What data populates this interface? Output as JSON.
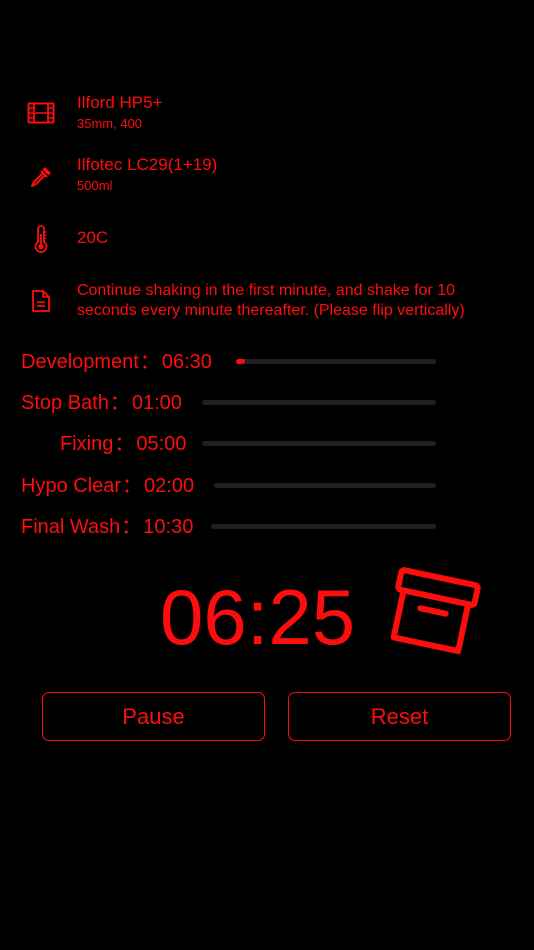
{
  "film": {
    "icon": "film-icon",
    "name": "Ilford HP5+",
    "detail": "35mm, 400"
  },
  "developer": {
    "icon": "dropper-icon",
    "name": "Ilfotec LC29(1+19)",
    "detail": "500ml"
  },
  "temperature": {
    "icon": "thermometer-icon",
    "value": "20C"
  },
  "instructions": {
    "icon": "document-icon",
    "text": "Continue shaking in the first minute, and shake for 10 seconds every minute thereafter. (Please flip vertically)"
  },
  "separator": "：",
  "steps": [
    {
      "label": "Development",
      "time": "06:30",
      "progress": 0.02
    },
    {
      "label": "Stop Bath",
      "time": "01:00",
      "progress": 0
    },
    {
      "label": "Fixing",
      "time": "05:00",
      "progress": 0
    },
    {
      "label": "Hypo Clear",
      "time": "02:00",
      "progress": 0
    },
    {
      "label": "Final Wash",
      "time": "10:30",
      "progress": 0
    }
  ],
  "timer": {
    "value": "06:25",
    "icon": "storage-box-icon"
  },
  "buttons": {
    "pause": "Pause",
    "reset": "Reset"
  },
  "colors": {
    "accent": "#ff0d0d",
    "background": "#000000",
    "track": "#202020"
  }
}
